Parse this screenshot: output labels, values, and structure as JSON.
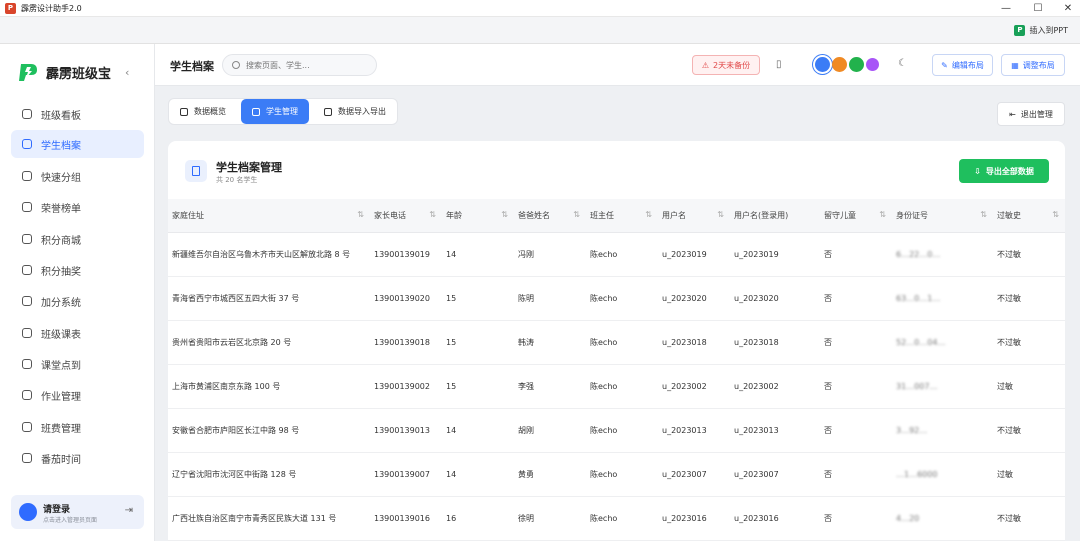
{
  "window": {
    "title": "霹雳设计助手2.0",
    "app_icon": "P"
  },
  "ppt_toolbar": {
    "insert_label": "插入到PPT",
    "icon": "P"
  },
  "brand": {
    "name": "霹雳班级宝",
    "accent": "#1fbf5e"
  },
  "sidebar": {
    "items": [
      {
        "label": "班级看板",
        "icon": "chart-icon"
      },
      {
        "label": "学生档案",
        "icon": "people-icon",
        "active": true
      },
      {
        "label": "快速分组",
        "icon": "group-icon"
      },
      {
        "label": "荣誉榜单",
        "icon": "trophy-icon"
      },
      {
        "label": "积分商城",
        "icon": "shop-icon"
      },
      {
        "label": "积分抽奖",
        "icon": "gift-icon"
      },
      {
        "label": "加分系统",
        "icon": "plus-icon"
      },
      {
        "label": "班级课表",
        "icon": "calendar-icon"
      },
      {
        "label": "课堂点到",
        "icon": "check-icon"
      },
      {
        "label": "作业管理",
        "icon": "book-icon"
      },
      {
        "label": "班费管理",
        "icon": "wallet-icon"
      },
      {
        "label": "番茄时间",
        "icon": "timer-icon"
      }
    ],
    "user": {
      "login_label": "请登录",
      "hint": "点击进入管理员页面"
    }
  },
  "header": {
    "title": "学生档案",
    "search_placeholder": "搜索页面、学生...",
    "backup_warning": "2天未备份",
    "theme_colors": [
      "#3b7cf6",
      "#f08a24",
      "#22b24c",
      "#a855f7"
    ],
    "edit_layout": "编辑布局",
    "adjust_layout": "调整布局"
  },
  "tabs": [
    {
      "label": "数据概览",
      "active": false
    },
    {
      "label": "学生管理",
      "active": true
    },
    {
      "label": "数据导入导出",
      "active": false
    }
  ],
  "exit_button": "退出管理",
  "panel": {
    "title": "学生档案管理",
    "subtitle": "共 20 名学生",
    "export_button": "导出全部数据"
  },
  "table": {
    "columns": [
      "家庭住址",
      "家长电话",
      "年龄",
      "爸爸姓名",
      "班主任",
      "用户名",
      "用户名(登录用)",
      "留守儿童",
      "身份证号",
      "过敏史"
    ],
    "rows": [
      [
        "新疆维吾尔自治区乌鲁木齐市天山区解放北路 8 号",
        "13900139019",
        "14",
        "冯刚",
        "陈echo",
        "u_2023019",
        "u_2023019",
        "否",
        "6…22…0…",
        "不过敏"
      ],
      [
        "青海省西宁市城西区五四大街 37 号",
        "13900139020",
        "15",
        "陈明",
        "陈echo",
        "u_2023020",
        "u_2023020",
        "否",
        "63…0…1…",
        "不过敏"
      ],
      [
        "贵州省贵阳市云岩区北京路 20 号",
        "13900139018",
        "15",
        "韩涛",
        "陈echo",
        "u_2023018",
        "u_2023018",
        "否",
        "52…0…04…",
        "不过敏"
      ],
      [
        "上海市黄浦区南京东路 100 号",
        "13900139002",
        "15",
        "李强",
        "陈echo",
        "u_2023002",
        "u_2023002",
        "否",
        "31…007…",
        "过敏"
      ],
      [
        "安徽省合肥市庐阳区长江中路 98 号",
        "13900139013",
        "14",
        "胡刚",
        "陈echo",
        "u_2023013",
        "u_2023013",
        "否",
        "3…92…",
        "不过敏"
      ],
      [
        "辽宁省沈阳市沈河区中街路 128 号",
        "13900139007",
        "14",
        "黄勇",
        "陈echo",
        "u_2023007",
        "u_2023007",
        "否",
        "…1…6000",
        "过敏"
      ],
      [
        "广西壮族自治区南宁市青秀区民族大道 131 号",
        "13900139016",
        "16",
        "徐明",
        "陈echo",
        "u_2023016",
        "u_2023016",
        "否",
        "4…20",
        "不过敏"
      ]
    ]
  }
}
